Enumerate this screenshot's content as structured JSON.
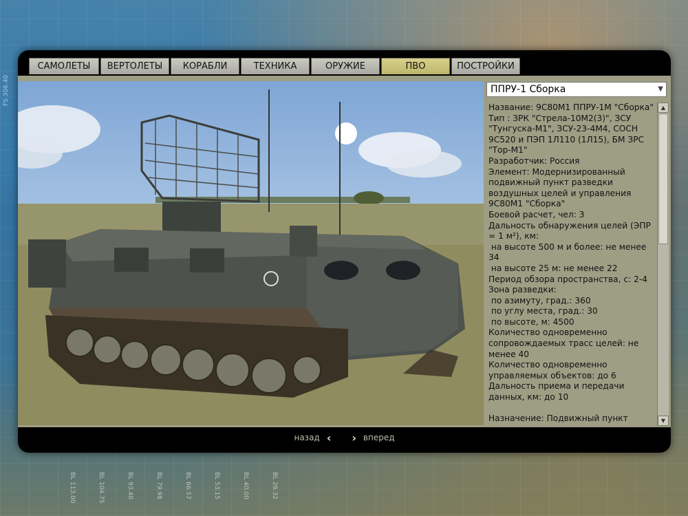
{
  "side_label": "FS 306.40",
  "bl_labels": [
    "BL 113.00",
    "BL 104.75",
    "BL 93.40",
    "BL 79.98",
    "BL 66.57",
    "BL 53.15",
    "BL 40.00",
    "BL 26.32"
  ],
  "tabs": [
    {
      "label": "САМОЛЕТЫ",
      "active": false
    },
    {
      "label": "ВЕРТОЛЕТЫ",
      "active": false
    },
    {
      "label": "КОРАБЛИ",
      "active": false
    },
    {
      "label": "ТЕХНИКА",
      "active": false
    },
    {
      "label": "ОРУЖИЕ",
      "active": false
    },
    {
      "label": "ПВО",
      "active": true
    },
    {
      "label": "ПОСТРОЙКИ",
      "active": false
    }
  ],
  "selector": {
    "value": "ППРУ-1 Сборка"
  },
  "info_lines": [
    "Название: 9С80М1 ППРУ-1М \"Сборка\"",
    "Тип : ЗРК \"Стрела-10М2(3)\", ЗСУ",
    "\"Тунгуска-М1\", ЗСУ-23-4М4, СОСН",
    "9С520 и ПЭП 1Л110 (1Л15), БМ ЗРС",
    "\"Тор-М1\"",
    "Разработчик: Россия",
    "Элемент: Модернизированный",
    "подвижный пункт разведки",
    "воздушных целей и управления",
    "9С80М1 \"Сборка\"",
    "Боевой расчет, чел: 3",
    "Дальность обнаружения целей (ЭПР",
    "= 1 м²), км:",
    " на высоте 500 м и более: не менее",
    "34",
    " на высоте 25 м: не менее 22",
    "Период обзора пространства, с: 2-4",
    "Зона разведки:",
    " по азимуту, град.: 360",
    " по углу места, град.: 30",
    " по высоте, м: 4500",
    "Количество одновременно",
    "сопровождаемых трасс целей: не",
    "менее 40",
    "Количество одновременно",
    "управляемых объектов: до 6",
    "Дальность приема и передачи",
    "данных, км: до 10",
    "",
    "Назначение: Подвижный пункт"
  ],
  "nav": {
    "back": "назад",
    "forward": "вперед"
  },
  "colors": {
    "active_tab": "#d8d18a",
    "panel": "#9e9e85",
    "window": "#000000"
  }
}
